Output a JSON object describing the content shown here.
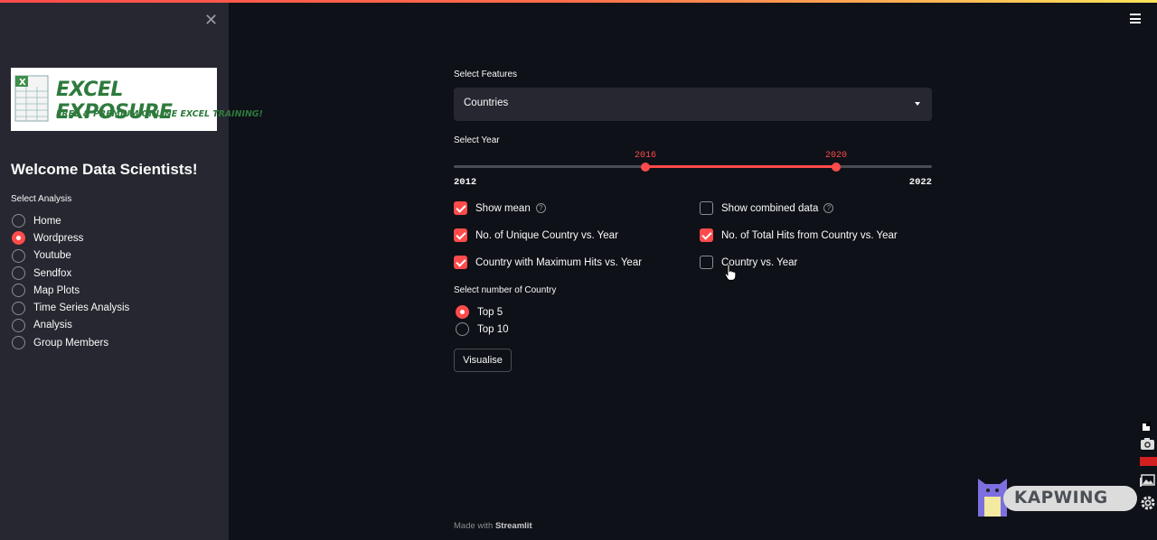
{
  "sidebar": {
    "logo": {
      "title": "EXCEL EXPOSURE",
      "tagline": "FREE & PREMIUM ONLINE EXCEL TRAINING!"
    },
    "welcome": "Welcome Data Scientists!",
    "analysis_label": "Select Analysis",
    "analysis_options": [
      "Home",
      "Wordpress",
      "Youtube",
      "Sendfox",
      "Map Plots",
      "Time Series Analysis",
      "Analysis",
      "Group Members"
    ],
    "analysis_selected": "Wordpress"
  },
  "main": {
    "features_label": "Select Features",
    "features_value": "Countries",
    "year_label": "Select Year",
    "year_range": {
      "min": "2012",
      "max": "2022",
      "low": "2016",
      "high": "2020"
    },
    "checkboxes": [
      {
        "label": "Show mean",
        "checked": true,
        "help": "?"
      },
      {
        "label": "Show combined data",
        "checked": false,
        "help": "?"
      },
      {
        "label": "No. of Unique Country vs. Year",
        "checked": true
      },
      {
        "label": "No. of Total Hits from Country vs. Year",
        "checked": true
      },
      {
        "label": "Country with Maximum Hits vs. Year",
        "checked": true
      },
      {
        "label": "Country vs. Year",
        "checked": false
      }
    ],
    "country_label": "Select number of Country",
    "country_options": [
      "Top 5",
      "Top 10"
    ],
    "country_selected": "Top 5",
    "visualise_button": "Visualise",
    "footer_prefix": "Made with",
    "footer_brand": "Streamlit"
  },
  "watermark": "KAPWING",
  "colors": {
    "accent": "#ff4b4b",
    "background": "#0e1117",
    "sidebar": "#262730"
  }
}
